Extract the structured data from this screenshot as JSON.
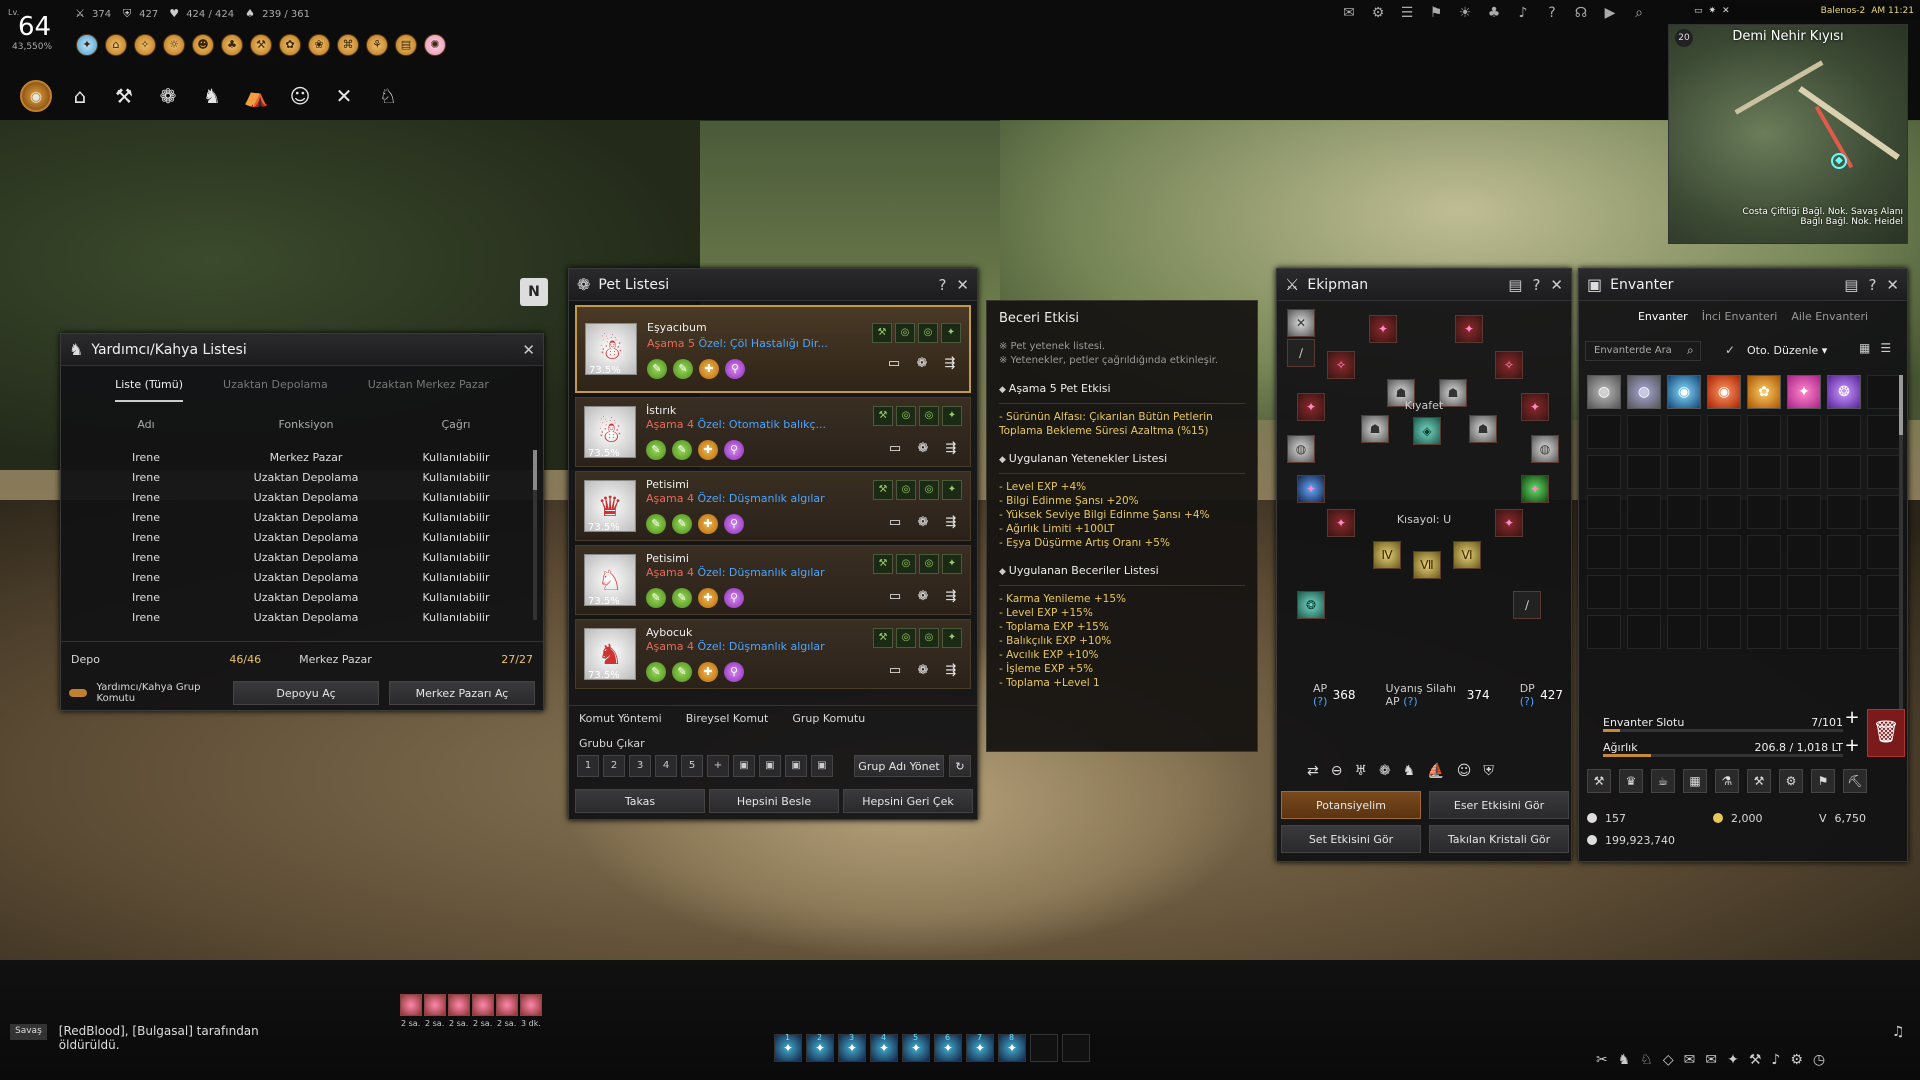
{
  "hud": {
    "level_prefix": "Lv.",
    "level": "64",
    "exp_pct": "43,550%",
    "ap": "374",
    "dp": "427",
    "hp": "424 / 424",
    "sp": "239 / 361",
    "server": "Balenos-2",
    "time": "AM 11:21"
  },
  "minimap": {
    "title": "Demi Nehir Kıyısı",
    "zoom": "20",
    "label": "Costa Çiftliği Bağl. Nok. Savaş Alanı\nBağlı Bağl. Nok. Heidel"
  },
  "nmark": "N",
  "yard": {
    "title": "Yardımcı/Kahya Listesi",
    "tabs": [
      "Liste (Tümü)",
      "Uzaktan Depolama",
      "Uzaktan Merkez Pazar"
    ],
    "cols": [
      "Adı",
      "Fonksiyon",
      "Çağrı"
    ],
    "rows": [
      [
        "Irene",
        "Merkez Pazar",
        "Kullanılabilir"
      ],
      [
        "Irene",
        "Uzaktan Depolama",
        "Kullanılabilir"
      ],
      [
        "Irene",
        "Uzaktan Depolama",
        "Kullanılabilir"
      ],
      [
        "Irene",
        "Uzaktan Depolama",
        "Kullanılabilir"
      ],
      [
        "Irene",
        "Uzaktan Depolama",
        "Kullanılabilir"
      ],
      [
        "Irene",
        "Uzaktan Depolama",
        "Kullanılabilir"
      ],
      [
        "Irene",
        "Uzaktan Depolama",
        "Kullanılabilir"
      ],
      [
        "Irene",
        "Uzaktan Depolama",
        "Kullanılabilir"
      ],
      [
        "Irene",
        "Uzaktan Depolama",
        "Kullanılabilir"
      ]
    ],
    "depo_label": "Depo",
    "depo_count": "46/46",
    "pazar_label": "Merkez Pazar",
    "pazar_count": "27/27",
    "group_cmd": "Yardımcı/Kahya Grup Komutu",
    "btn_depo": "Depoyu Aç",
    "btn_pazar": "Merkez Pazarı Aç"
  },
  "pet": {
    "title": "Pet Listesi",
    "pets": [
      {
        "name": "Eşyacıbum",
        "stage": "Aşama 5",
        "special": "Özel: Çöl Hastalığı Dir...",
        "pct": "73.5%"
      },
      {
        "name": "İstırık",
        "stage": "Aşama 4",
        "special": "Özel: Otomatik balıkç...",
        "pct": "73.5%"
      },
      {
        "name": "Petisimi",
        "stage": "Aşama 4",
        "special": "Özel: Düşmanlık algılar",
        "pct": "73.5%"
      },
      {
        "name": "Petisimi",
        "stage": "Aşama 4",
        "special": "Özel: Düşmanlık algılar",
        "pct": "73.5%"
      },
      {
        "name": "Aybocuk",
        "stage": "Aşama 4",
        "special": "Özel: Düşmanlık algılar",
        "pct": "73.5%"
      }
    ],
    "cmd_method": "Komut Yöntemi",
    "cmd_indiv": "Bireysel Komut",
    "cmd_group": "Grup Komutu",
    "group_out": "Grubu Çıkar",
    "group_nums": [
      "1",
      "2",
      "3",
      "4",
      "5",
      "+"
    ],
    "group_name": "Grup Adı Yönet",
    "btn_trade": "Takas",
    "btn_feed": "Hepsini Besle",
    "btn_recall": "Hepsini Geri Çek"
  },
  "beceri": {
    "title": "Beceri Etkisi",
    "notes": [
      "※ Pet yetenek listesi.",
      "※ Yetenekler, petler çağrıldığında etkinleşir."
    ],
    "sec1": "Aşama 5 Pet Etkisi",
    "sec1_items": [
      "- Sürünün Alfası: Çıkarılan Bütün Petlerin Toplama Bekleme Süresi Azaltma (%15)"
    ],
    "sec2": "Uygulanan Yetenekler Listesi",
    "sec2_items": [
      "- Level EXP +4%",
      "- Bilgi Edinme Şansı +20%",
      "- Yüksek Seviye Bilgi Edinme Şansı +4%",
      "- Ağırlık Limiti +100LT",
      "- Eşya Düşürme Artış Oranı +5%"
    ],
    "sec3": "Uygulanan Beceriler Listesi",
    "sec3_items": [
      "- Karma Yenileme +15%",
      "- Level EXP +15%",
      "- Toplama EXP +15%",
      "- Balıkçılık EXP +10%",
      "- Avcılık EXP +10%",
      "- İşleme EXP +5%",
      "- Toplama +Level 1"
    ]
  },
  "eki": {
    "title": "Ekipman",
    "kiyafet": "Kıyafet",
    "kisayol": "Kısayol: U",
    "ap_label": "AP",
    "ap": "368",
    "awak_label": "Uyanış Silahı AP",
    "awak": "374",
    "dp_label": "DP",
    "dp": "427",
    "q": "(?)",
    "btn_pot": "Potansiyelim",
    "btn_eser": "Eser Etkisini Gör",
    "btn_set": "Set Etkisini Gör",
    "btn_kristal": "Takılan Kristali Gör"
  },
  "env": {
    "title": "Envanter",
    "tabs": [
      "Envanter",
      "İnci Envanteri",
      "Aile Envanteri"
    ],
    "search": "Envanterde Ara",
    "sort": "Oto. Düzenle",
    "slot_label": "Envanter Slotu",
    "slot_val": "7/101",
    "slot_fill": 0.07,
    "weight_label": "Ağırlık",
    "weight_val": "206.8 / 1,018 LT",
    "weight_fill": 0.2,
    "silver_small": "157",
    "gold": "2,000",
    "v_label": "V",
    "v_val": "6,750",
    "silver": "199,923,740"
  },
  "bottom": {
    "chat_tag": "Savaş",
    "chat_msg": "[RedBlood], [Bulgasal] tarafından öldürüldü.",
    "buff_times": [
      "2 sa.",
      "2 sa.",
      "2 sa.",
      "2 sa.",
      "2 sa.",
      "3 dk."
    ],
    "quick_nums": [
      "1",
      "2",
      "3",
      "4",
      "5",
      "6",
      "7",
      "8"
    ]
  }
}
